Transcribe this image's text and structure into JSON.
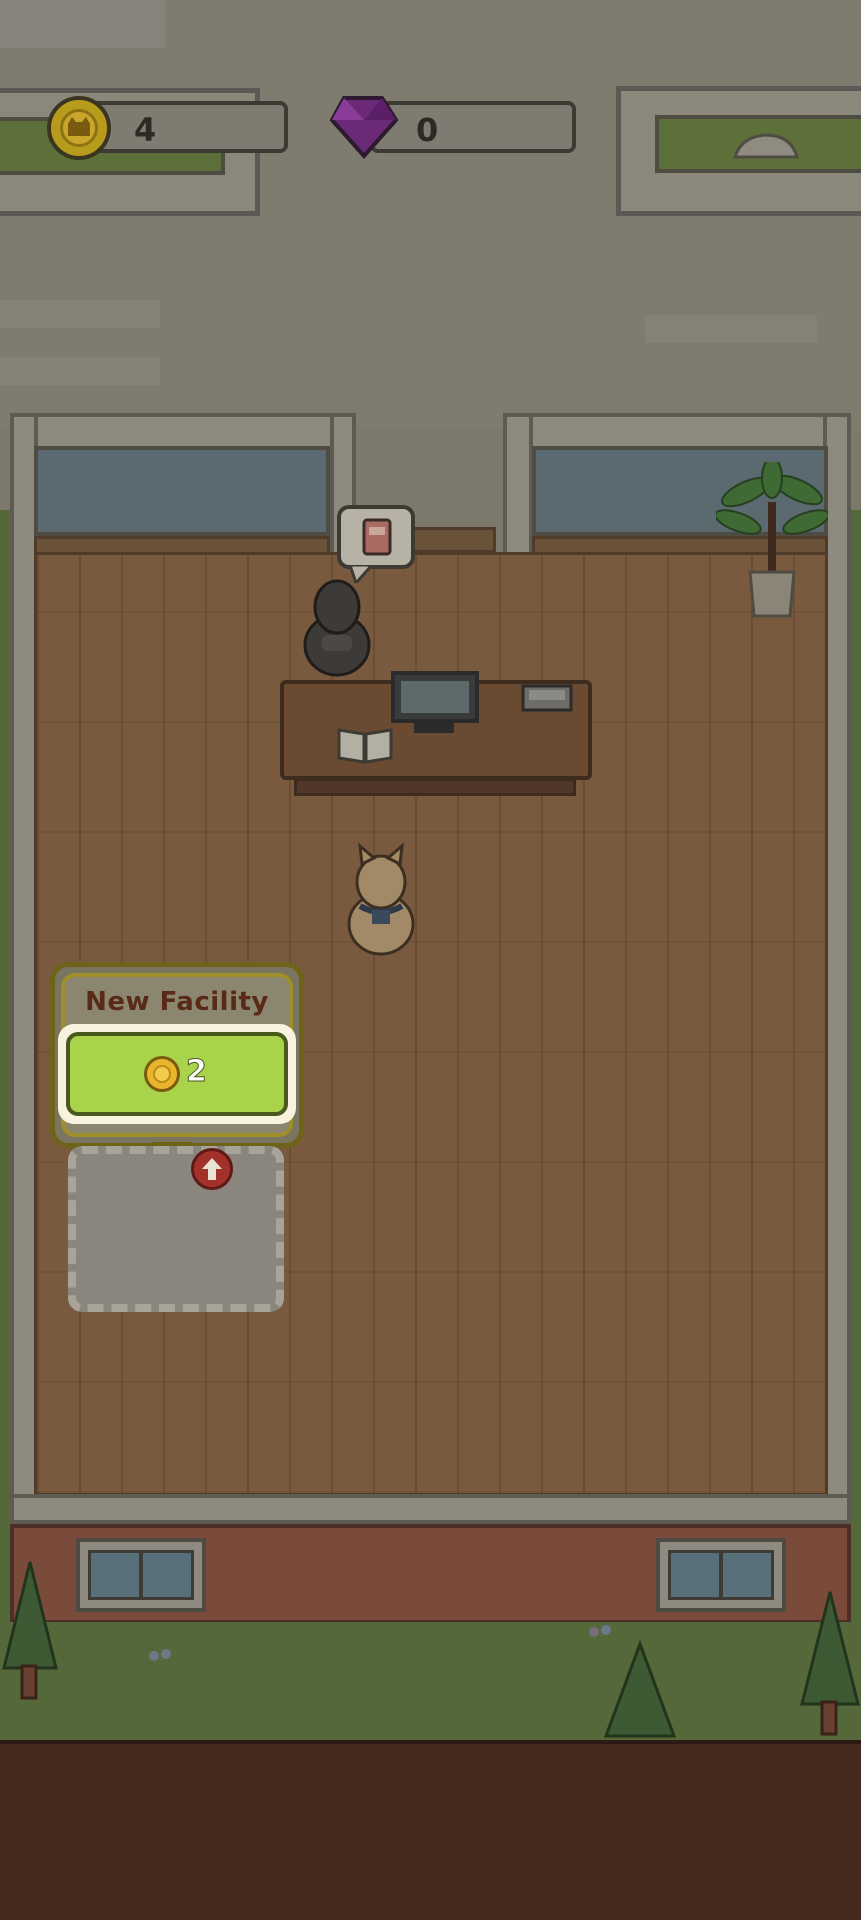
{
  "hud": {
    "coins": {
      "icon": "cat-coin-icon",
      "value": "4"
    },
    "gems": {
      "icon": "purple-gem-icon",
      "value": "0"
    }
  },
  "popup": {
    "title": "New Facility",
    "buy_button": {
      "icon": "cat-coin-icon",
      "price": "2"
    },
    "arrow_icon": "up-arrow-icon"
  },
  "speech_bubble": {
    "icon": "red-book-icon"
  },
  "colors": {
    "floor": "#7a5a3e",
    "buy_button_green": "#a9d34a",
    "popup_title": "#5a2a18",
    "coin": "#c9a52a",
    "gem": "#7a2a86"
  }
}
